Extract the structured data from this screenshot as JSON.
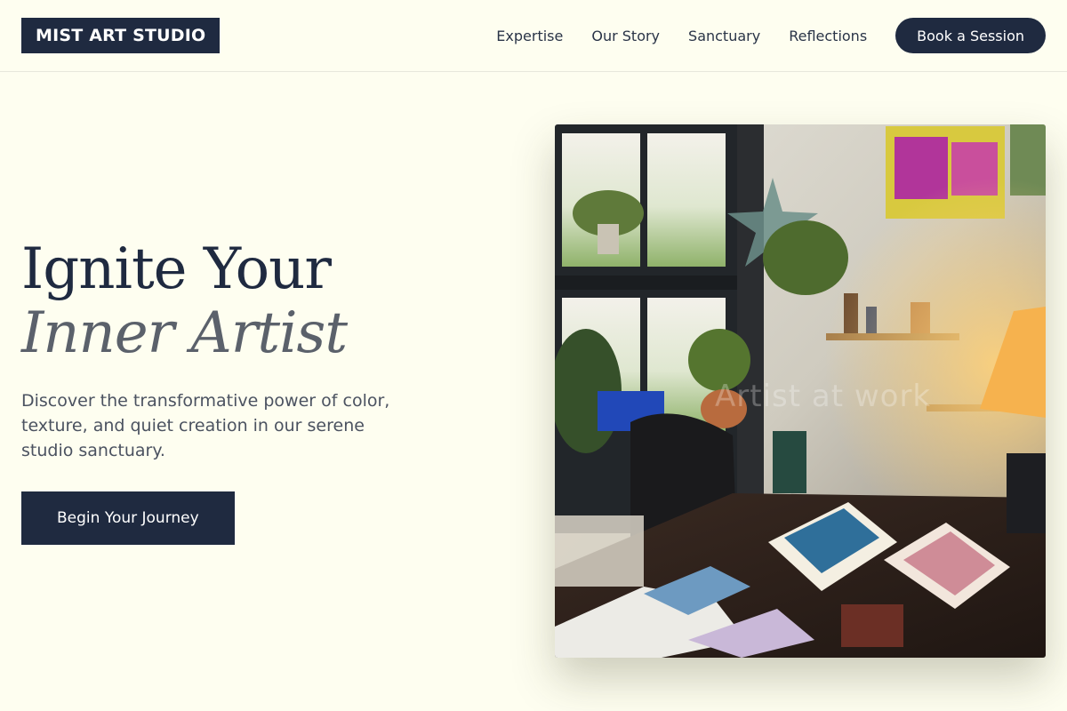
{
  "header": {
    "logo": "MIST ART STUDIO",
    "nav": [
      "Expertise",
      "Our Story",
      "Sanctuary",
      "Reflections"
    ],
    "cta": "Book a Session"
  },
  "hero": {
    "title_line1": "Ignite Your",
    "title_line2": "Inner Artist",
    "subtitle": "Discover the transformative power of color, texture, and quiet creation in our serene studio sanctuary.",
    "button": "Begin Your Journey",
    "image_caption": "Artist at work"
  },
  "colors": {
    "background": "#fefef0",
    "primary": "#1f2a40",
    "muted_text": "#5b616b"
  }
}
